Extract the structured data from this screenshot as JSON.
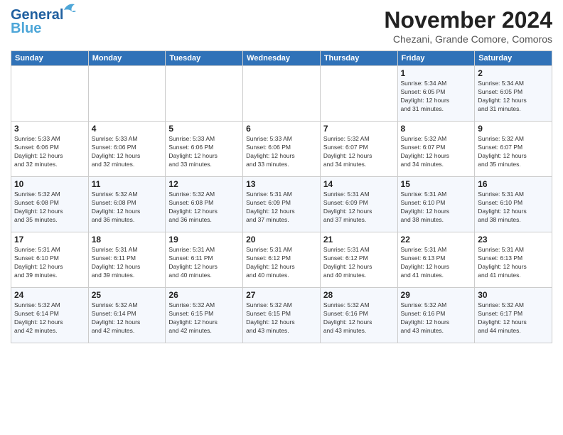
{
  "header": {
    "logo_line1": "General",
    "logo_line2": "Blue",
    "month": "November 2024",
    "location": "Chezani, Grande Comore, Comoros"
  },
  "days_of_week": [
    "Sunday",
    "Monday",
    "Tuesday",
    "Wednesday",
    "Thursday",
    "Friday",
    "Saturday"
  ],
  "weeks": [
    [
      {
        "day": "",
        "info": ""
      },
      {
        "day": "",
        "info": ""
      },
      {
        "day": "",
        "info": ""
      },
      {
        "day": "",
        "info": ""
      },
      {
        "day": "",
        "info": ""
      },
      {
        "day": "1",
        "info": "Sunrise: 5:34 AM\nSunset: 6:05 PM\nDaylight: 12 hours\nand 31 minutes."
      },
      {
        "day": "2",
        "info": "Sunrise: 5:34 AM\nSunset: 6:05 PM\nDaylight: 12 hours\nand 31 minutes."
      }
    ],
    [
      {
        "day": "3",
        "info": "Sunrise: 5:33 AM\nSunset: 6:06 PM\nDaylight: 12 hours\nand 32 minutes."
      },
      {
        "day": "4",
        "info": "Sunrise: 5:33 AM\nSunset: 6:06 PM\nDaylight: 12 hours\nand 32 minutes."
      },
      {
        "day": "5",
        "info": "Sunrise: 5:33 AM\nSunset: 6:06 PM\nDaylight: 12 hours\nand 33 minutes."
      },
      {
        "day": "6",
        "info": "Sunrise: 5:33 AM\nSunset: 6:06 PM\nDaylight: 12 hours\nand 33 minutes."
      },
      {
        "day": "7",
        "info": "Sunrise: 5:32 AM\nSunset: 6:07 PM\nDaylight: 12 hours\nand 34 minutes."
      },
      {
        "day": "8",
        "info": "Sunrise: 5:32 AM\nSunset: 6:07 PM\nDaylight: 12 hours\nand 34 minutes."
      },
      {
        "day": "9",
        "info": "Sunrise: 5:32 AM\nSunset: 6:07 PM\nDaylight: 12 hours\nand 35 minutes."
      }
    ],
    [
      {
        "day": "10",
        "info": "Sunrise: 5:32 AM\nSunset: 6:08 PM\nDaylight: 12 hours\nand 35 minutes."
      },
      {
        "day": "11",
        "info": "Sunrise: 5:32 AM\nSunset: 6:08 PM\nDaylight: 12 hours\nand 36 minutes."
      },
      {
        "day": "12",
        "info": "Sunrise: 5:32 AM\nSunset: 6:08 PM\nDaylight: 12 hours\nand 36 minutes."
      },
      {
        "day": "13",
        "info": "Sunrise: 5:31 AM\nSunset: 6:09 PM\nDaylight: 12 hours\nand 37 minutes."
      },
      {
        "day": "14",
        "info": "Sunrise: 5:31 AM\nSunset: 6:09 PM\nDaylight: 12 hours\nand 37 minutes."
      },
      {
        "day": "15",
        "info": "Sunrise: 5:31 AM\nSunset: 6:10 PM\nDaylight: 12 hours\nand 38 minutes."
      },
      {
        "day": "16",
        "info": "Sunrise: 5:31 AM\nSunset: 6:10 PM\nDaylight: 12 hours\nand 38 minutes."
      }
    ],
    [
      {
        "day": "17",
        "info": "Sunrise: 5:31 AM\nSunset: 6:10 PM\nDaylight: 12 hours\nand 39 minutes."
      },
      {
        "day": "18",
        "info": "Sunrise: 5:31 AM\nSunset: 6:11 PM\nDaylight: 12 hours\nand 39 minutes."
      },
      {
        "day": "19",
        "info": "Sunrise: 5:31 AM\nSunset: 6:11 PM\nDaylight: 12 hours\nand 40 minutes."
      },
      {
        "day": "20",
        "info": "Sunrise: 5:31 AM\nSunset: 6:12 PM\nDaylight: 12 hours\nand 40 minutes."
      },
      {
        "day": "21",
        "info": "Sunrise: 5:31 AM\nSunset: 6:12 PM\nDaylight: 12 hours\nand 40 minutes."
      },
      {
        "day": "22",
        "info": "Sunrise: 5:31 AM\nSunset: 6:13 PM\nDaylight: 12 hours\nand 41 minutes."
      },
      {
        "day": "23",
        "info": "Sunrise: 5:31 AM\nSunset: 6:13 PM\nDaylight: 12 hours\nand 41 minutes."
      }
    ],
    [
      {
        "day": "24",
        "info": "Sunrise: 5:32 AM\nSunset: 6:14 PM\nDaylight: 12 hours\nand 42 minutes."
      },
      {
        "day": "25",
        "info": "Sunrise: 5:32 AM\nSunset: 6:14 PM\nDaylight: 12 hours\nand 42 minutes."
      },
      {
        "day": "26",
        "info": "Sunrise: 5:32 AM\nSunset: 6:15 PM\nDaylight: 12 hours\nand 42 minutes."
      },
      {
        "day": "27",
        "info": "Sunrise: 5:32 AM\nSunset: 6:15 PM\nDaylight: 12 hours\nand 43 minutes."
      },
      {
        "day": "28",
        "info": "Sunrise: 5:32 AM\nSunset: 6:16 PM\nDaylight: 12 hours\nand 43 minutes."
      },
      {
        "day": "29",
        "info": "Sunrise: 5:32 AM\nSunset: 6:16 PM\nDaylight: 12 hours\nand 43 minutes."
      },
      {
        "day": "30",
        "info": "Sunrise: 5:32 AM\nSunset: 6:17 PM\nDaylight: 12 hours\nand 44 minutes."
      }
    ]
  ]
}
